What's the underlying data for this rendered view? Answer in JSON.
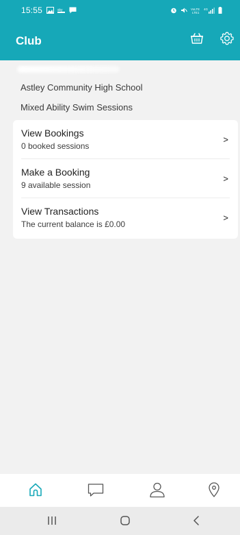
{
  "status_bar": {
    "time": "15:55",
    "left_icons": [
      "gallery-icon",
      "sky-notification-icon",
      "message-icon"
    ],
    "right_icons": [
      "alarm-icon",
      "mute-icon",
      "volte-icon",
      "4g-signal-icon",
      "battery-icon"
    ]
  },
  "app_bar": {
    "title": "Club",
    "actions": [
      "basket-icon",
      "settings-icon"
    ]
  },
  "club": {
    "school": "Astley Community High School",
    "session_type": "Mixed Ability Swim Sessions"
  },
  "menu": [
    {
      "title": "View Bookings",
      "subtitle": "0 booked sessions",
      "chevron": ">"
    },
    {
      "title": "Make a Booking",
      "subtitle": "9 available session",
      "chevron": ">"
    },
    {
      "title": "View Transactions",
      "subtitle": "The current balance is £0.00",
      "chevron": ">"
    }
  ],
  "bottom_nav": {
    "items": [
      "home-icon",
      "chat-icon",
      "profile-icon",
      "location-icon"
    ],
    "active": "home-icon"
  },
  "colors": {
    "brand": "#16a8b8",
    "background": "#f2f2f2",
    "card": "#ffffff"
  }
}
